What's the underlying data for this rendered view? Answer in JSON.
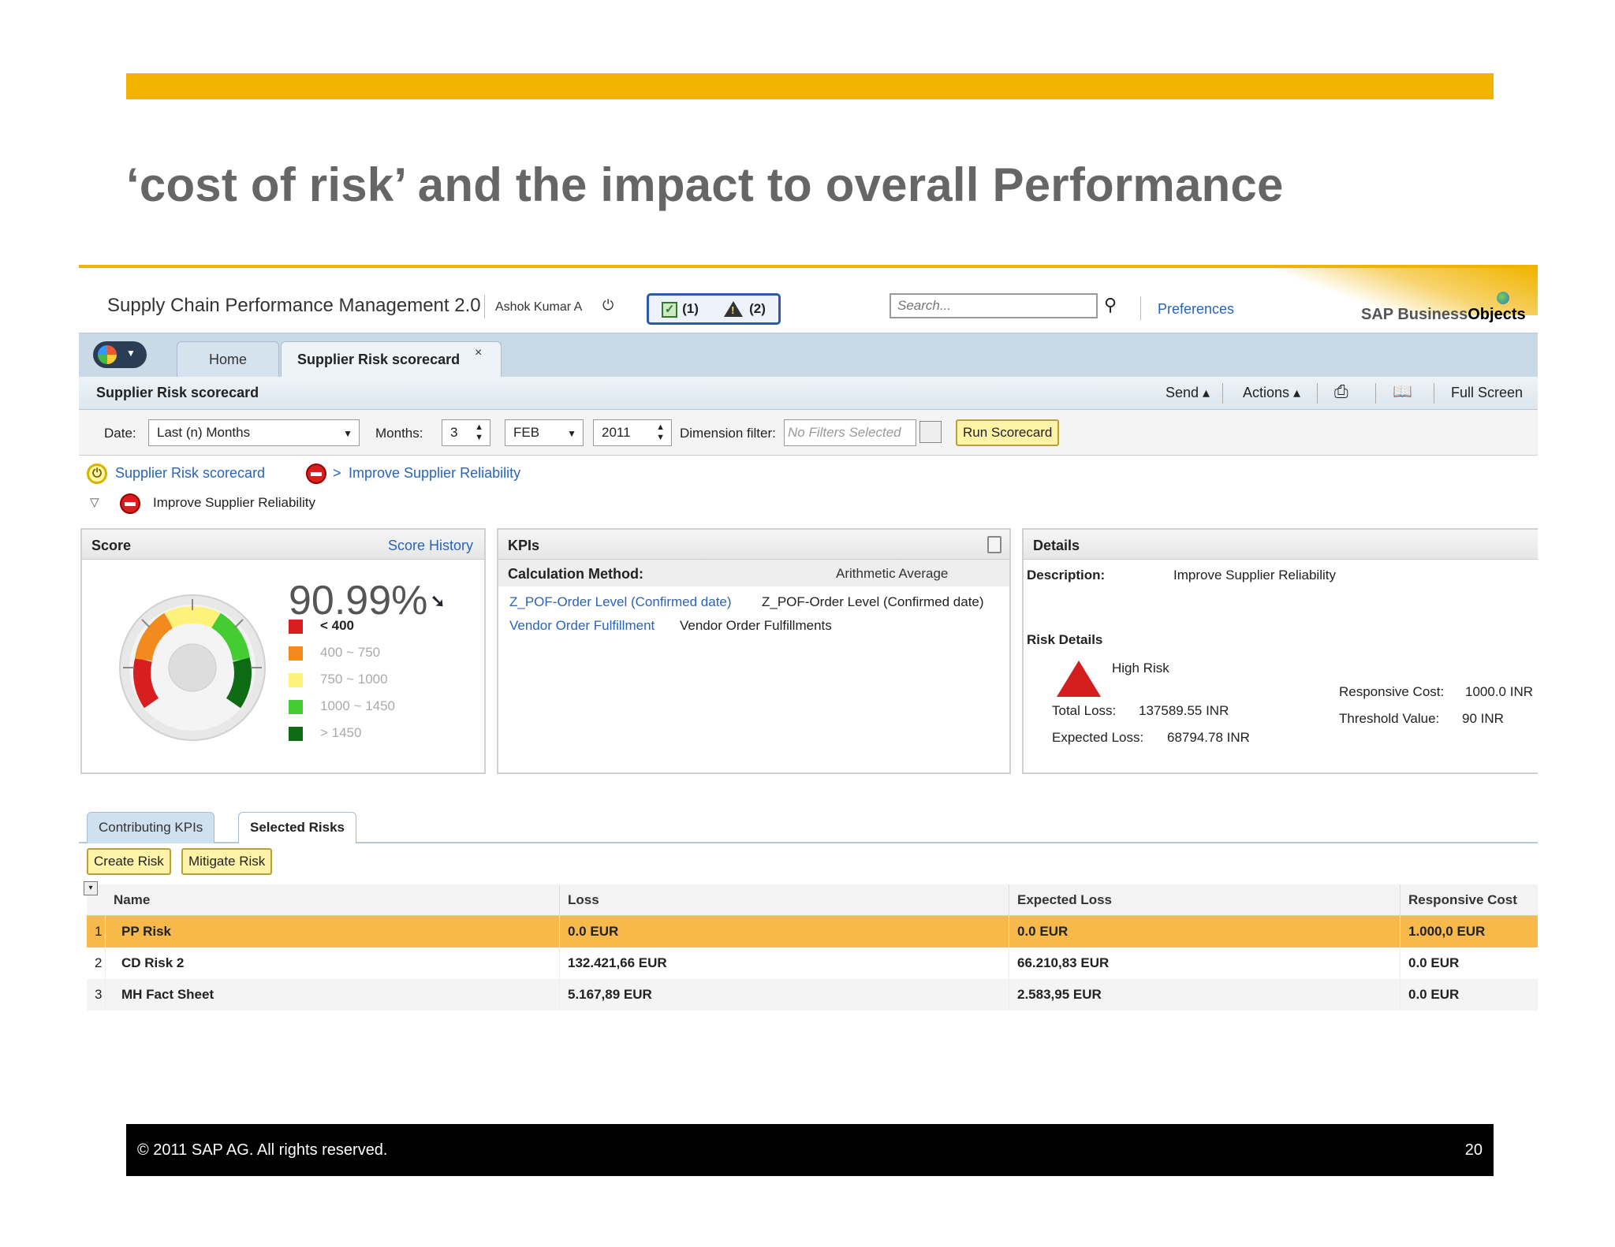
{
  "slide": {
    "title": "‘cost of risk’ and the impact to overall Performance",
    "copyright": "©  2011 SAP AG. All rights reserved.",
    "page_number": "20"
  },
  "colors": {
    "accent": "#f0b400",
    "link": "#2a64b8",
    "selected_row": "#f7b94a"
  },
  "header": {
    "app_title": "Supply Chain Performance Management 2.0",
    "user_name": "Ashok Kumar A",
    "alerts_ok": "(1)",
    "alerts_warn": "(2)",
    "search_placeholder": "Search...",
    "preferences": "Preferences",
    "logo_part1": "SAP Business",
    "logo_part2": "Objects"
  },
  "tabs": {
    "home": "Home",
    "scorecard": "Supplier Risk scorecard",
    "close": "×"
  },
  "toolbar": {
    "title": "Supplier Risk scorecard",
    "send": "Send ▴",
    "actions": "Actions ▴",
    "full_screen": "Full Screen"
  },
  "filters": {
    "date_label": "Date:",
    "date_value": "Last (n) Months",
    "months_label": "Months:",
    "months_value": "3",
    "month_value": "FEB",
    "year_value": "2011",
    "dimension_label": "Dimension filter:",
    "dimension_placeholder": "No Filters Selected",
    "run_button": "Run Scorecard"
  },
  "breadcrumb": {
    "root": "Supplier Risk scorecard",
    "separator": ">",
    "current": "Improve Supplier Reliability"
  },
  "tree": {
    "label": "Improve Supplier Reliability"
  },
  "score": {
    "title": "Score",
    "history_link": "Score History",
    "value": "90.99%",
    "legend": [
      {
        "label": "< 400",
        "color": "#d81e1e",
        "active": true
      },
      {
        "label": "400 ~ 750",
        "color": "#f28a1e",
        "active": false
      },
      {
        "label": "750 ~ 1000",
        "color": "#fff27a",
        "active": false
      },
      {
        "label": "1000 ~ 1450",
        "color": "#44cc33",
        "active": false
      },
      {
        "label": "> 1450",
        "color": "#0d6b13",
        "active": false
      }
    ]
  },
  "kpis": {
    "title": "KPIs",
    "calc_label": "Calculation Method:",
    "calc_value": "Arithmetic Average",
    "rows": [
      {
        "name": "Z_POF-Order Level (Confirmed date)",
        "desc": "Z_POF-Order Level (Confirmed date)"
      },
      {
        "name": "Vendor Order Fulfillment",
        "desc": "Vendor Order Fulfillments"
      }
    ]
  },
  "details": {
    "title": "Details",
    "description_label": "Description:",
    "description_value": "Improve Supplier Reliability",
    "risk_details_label": "Risk Details",
    "risk_level": "High Risk",
    "total_loss_label": "Total Loss:",
    "total_loss_value": "137589.55 INR",
    "expected_loss_label": "Expected Loss:",
    "expected_loss_value": "68794.78 INR",
    "responsive_cost_label": "Responsive Cost:",
    "responsive_cost_value": "1000.0 INR",
    "threshold_label": "Threshold Value:",
    "threshold_value": "90 INR"
  },
  "lower_tabs": {
    "contributing": "Contributing KPIs",
    "selected": "Selected Risks"
  },
  "buttons": {
    "create_risk": "Create Risk",
    "mitigate_risk": "Mitigate Risk"
  },
  "table": {
    "headers": [
      "Name",
      "Loss",
      "Expected Loss",
      "Responsive Cost"
    ],
    "rows": [
      {
        "num": "1",
        "name": "PP Risk",
        "loss": "0.0 EUR",
        "expected": "0.0 EUR",
        "cost": "1.000,0 EUR"
      },
      {
        "num": "2",
        "name": "CD Risk 2",
        "loss": "132.421,66 EUR",
        "expected": "66.210,83 EUR",
        "cost": "0.0 EUR"
      },
      {
        "num": "3",
        "name": "MH Fact Sheet",
        "loss": "5.167,89 EUR",
        "expected": "2.583,95 EUR",
        "cost": "0.0 EUR"
      }
    ]
  }
}
